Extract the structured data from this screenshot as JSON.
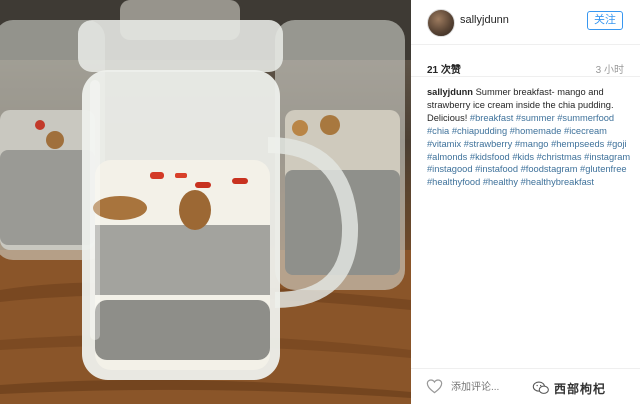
{
  "post": {
    "username": "sallyjdunn",
    "follow_label": "关注",
    "likes_label": "21 次赞",
    "time_label": "3 小时",
    "caption_user": "sallyjdunn",
    "caption_text": "Summer breakfast- mango and strawberry ice cream inside the chia pudding. Delicious!",
    "hashtags": [
      "#breakfast",
      "#summer",
      "#summerfood",
      "#chia",
      "#chiapudding",
      "#homemade",
      "#icecream",
      "#vitamix",
      "#strawberry",
      "#mango",
      "#hempseeds",
      "#goji",
      "#almonds",
      "#kidsfood",
      "#kids",
      "#christmas",
      "#instagram",
      "#instagood",
      "#instafood",
      "#foodstagram",
      "#glutenfree",
      "#healthyfood",
      "#healthy",
      "#healthybreakfast"
    ],
    "comment_placeholder": "添加评论...",
    "watermark": "西部枸杞"
  },
  "photo": {
    "description": "mason jars of chia pudding topped with almonds and goji berries on a wooden table",
    "icons": [
      "heart-icon",
      "wechat-icon"
    ]
  },
  "colors": {
    "link": "#3f729b",
    "follow": "#3897f0",
    "text": "#262626",
    "muted": "#999999"
  }
}
